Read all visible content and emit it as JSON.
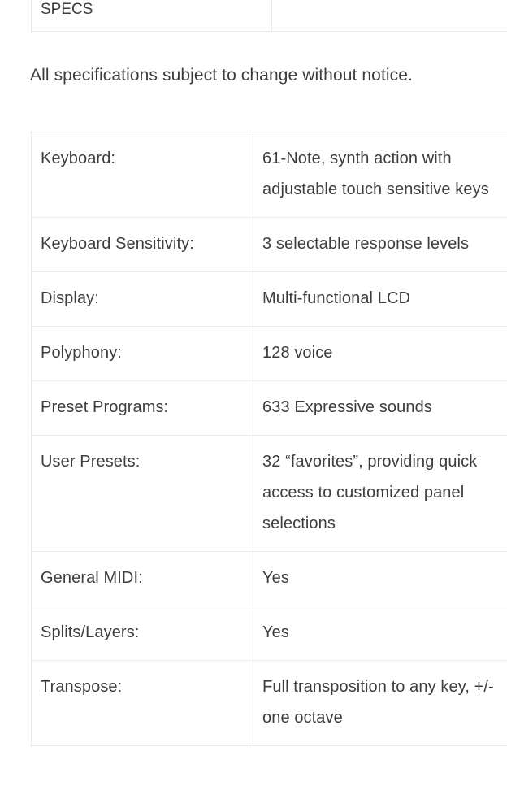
{
  "document": {
    "intro_note": "All specifications subject to change without notice.",
    "specs_header_table": {
      "rows": [
        {
          "label": "SPECS",
          "value": ""
        }
      ]
    },
    "spec_table": {
      "rows": [
        {
          "label": "Keyboard:",
          "value": "61-Note, synth action with adjustable touch sensitive keys"
        },
        {
          "label": "Keyboard Sensitivity:",
          "value": "3 selectable response levels"
        },
        {
          "label": "Display:",
          "value": "Multi-functional LCD"
        },
        {
          "label": "Polyphony:",
          "value": "128 voice"
        },
        {
          "label": "Preset Programs:",
          "value": "633 Expressive sounds"
        },
        {
          "label": "User Presets:",
          "value": "32 “favorites”, providing quick access to customized panel selections"
        },
        {
          "label": "General MIDI:",
          "value": "Yes"
        },
        {
          "label": "Splits/Layers:",
          "value": "Yes"
        },
        {
          "label": "Transpose:",
          "value": "Full transposition to any key, +/- one octave"
        }
      ]
    },
    "colors": {
      "text": "#3b3e40",
      "border": "#e9e9e9",
      "background": "#ffffff"
    }
  }
}
